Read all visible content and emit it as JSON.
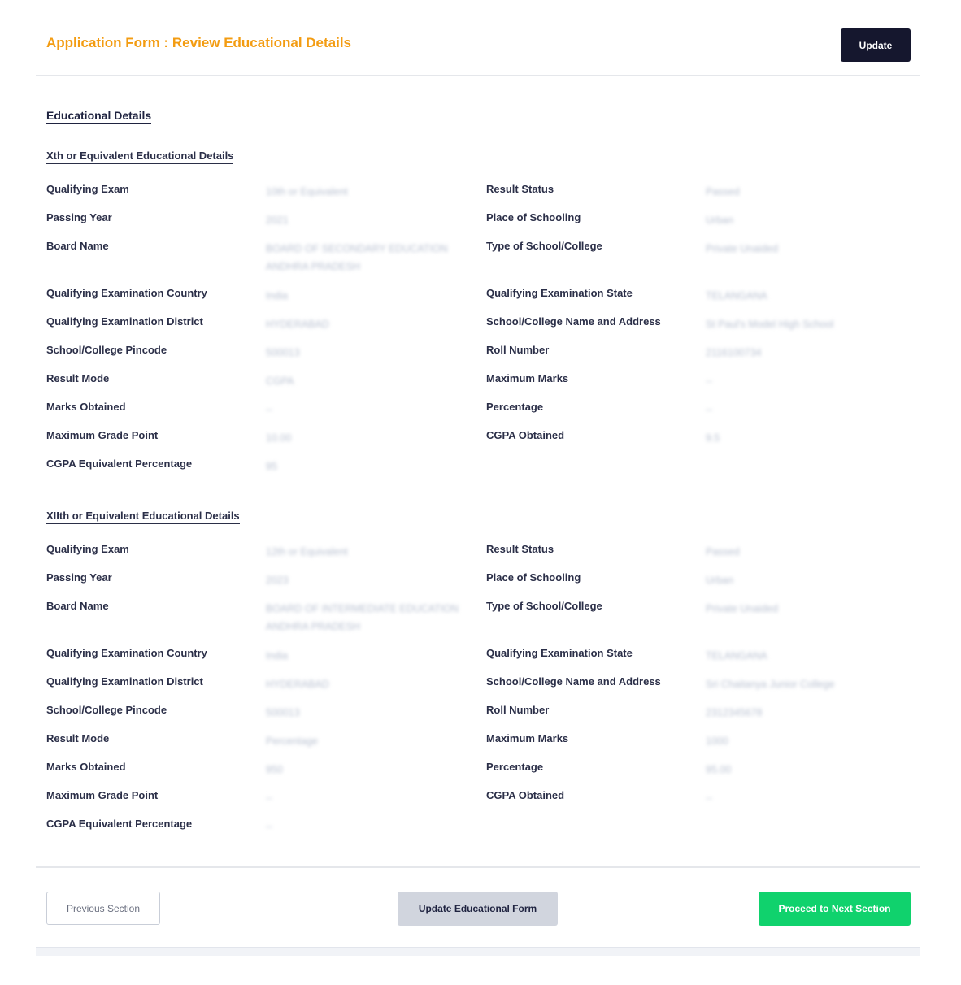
{
  "header": {
    "title": "Application Form : Review Educational Details",
    "update_label": "Update"
  },
  "section": {
    "title": "Educational Details"
  },
  "xth": {
    "heading": "Xth or Equivalent Educational Details",
    "rows": [
      {
        "left_label": "Qualifying Exam",
        "left_value": "10th or Equivalent",
        "right_label": "Result Status",
        "right_value": "Passed"
      },
      {
        "left_label": "Passing Year",
        "left_value": "2021",
        "right_label": "Place of Schooling",
        "right_value": "Urban"
      },
      {
        "left_label": "Board Name",
        "left_value": "BOARD OF SECONDARY EDUCATION ANDHRA PRADESH",
        "right_label": "Type of School/College",
        "right_value": "Private Unaided"
      },
      {
        "left_label": "Qualifying Examination Country",
        "left_value": "India",
        "right_label": "Qualifying Examination State",
        "right_value": "TELANGANA"
      },
      {
        "left_label": "Qualifying Examination District",
        "left_value": "HYDERABAD",
        "right_label": "School/College Name and Address",
        "right_value": "St Paul's Model High School"
      },
      {
        "left_label": "School/College Pincode",
        "left_value": "500013",
        "right_label": "Roll Number",
        "right_value": "2116100734"
      },
      {
        "left_label": "Result Mode",
        "left_value": "CGPA",
        "right_label": "Maximum Marks",
        "right_value": "--"
      },
      {
        "left_label": "Marks Obtained",
        "left_value": "--",
        "right_label": "Percentage",
        "right_value": "--"
      },
      {
        "left_label": "Maximum Grade Point",
        "left_value": "10.00",
        "right_label": "CGPA Obtained",
        "right_value": "9.5"
      },
      {
        "left_label": "CGPA Equivalent Percentage",
        "left_value": "95",
        "right_label": "",
        "right_value": ""
      }
    ]
  },
  "xiith": {
    "heading": "XIIth or Equivalent Educational Details",
    "rows": [
      {
        "left_label": "Qualifying Exam",
        "left_value": "12th or Equivalent",
        "right_label": "Result Status",
        "right_value": "Passed"
      },
      {
        "left_label": "Passing Year",
        "left_value": "2023",
        "right_label": "Place of Schooling",
        "right_value": "Urban"
      },
      {
        "left_label": "Board Name",
        "left_value": "BOARD OF INTERMEDIATE EDUCATION ANDHRA PRADESH",
        "right_label": "Type of School/College",
        "right_value": "Private Unaided"
      },
      {
        "left_label": "Qualifying Examination Country",
        "left_value": "India",
        "right_label": "Qualifying Examination State",
        "right_value": "TELANGANA"
      },
      {
        "left_label": "Qualifying Examination District",
        "left_value": "HYDERABAD",
        "right_label": "School/College Name and Address",
        "right_value": "Sri Chaitanya Junior College"
      },
      {
        "left_label": "School/College Pincode",
        "left_value": "500013",
        "right_label": "Roll Number",
        "right_value": "2312345678"
      },
      {
        "left_label": "Result Mode",
        "left_value": "Percentage",
        "right_label": "Maximum Marks",
        "right_value": "1000"
      },
      {
        "left_label": "Marks Obtained",
        "left_value": "950",
        "right_label": "Percentage",
        "right_value": "95.00"
      },
      {
        "left_label": "Maximum Grade Point",
        "left_value": "--",
        "right_label": "CGPA Obtained",
        "right_value": "--"
      },
      {
        "left_label": "CGPA Equivalent Percentage",
        "left_value": "--",
        "right_label": "",
        "right_value": ""
      }
    ]
  },
  "footer": {
    "previous_label": "Previous Section",
    "update_form_label": "Update Educational Form",
    "next_label": "Proceed to Next Section"
  }
}
